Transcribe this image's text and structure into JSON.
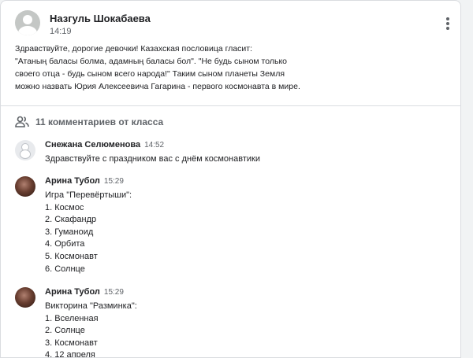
{
  "post": {
    "author": "Назгуль Шокабаева",
    "time": "14:19",
    "lines": [
      "Здравствуйте, дорогие девочки! Казахская пословица гласит:",
      "\"Атаның баласы болма, адамның баласы бол\". \"Не будь сыном только",
      "своего отца - будь сыном всего народа!\"  Таким сыном планеты Земля",
      "можно назвать Юрия Алексеевича Гагарина - первого космонавта в мире."
    ]
  },
  "comments_header": "11 комментариев от класса",
  "comments": [
    {
      "author": "Снежана Селюменова",
      "time": "14:52",
      "lines": [
        "Здравствуйте с праздником вас с днём космонавтики"
      ]
    },
    {
      "author": "Арина Тубол",
      "time": "15:29",
      "lines": [
        "Игра \"Перевёртыши\":",
        "1. Космос",
        "2. Скафандр",
        "3. Гуманоид",
        "4. Орбита",
        "5. Космонавт",
        "6. Солнце"
      ]
    },
    {
      "author": "Арина Тубол",
      "time": "15:29",
      "lines": [
        "Викторина \"Разминка\":",
        "1. Вселенная",
        "2. Солнце",
        "3. Космонавт",
        "4. 12 апреля"
      ]
    }
  ],
  "icons": {
    "more": "more-vert-icon",
    "people": "people-icon",
    "avatar": "account-circle-icon"
  },
  "colors": {
    "text": "#202124",
    "secondary": "#5f6368",
    "divider": "#dadce0"
  }
}
